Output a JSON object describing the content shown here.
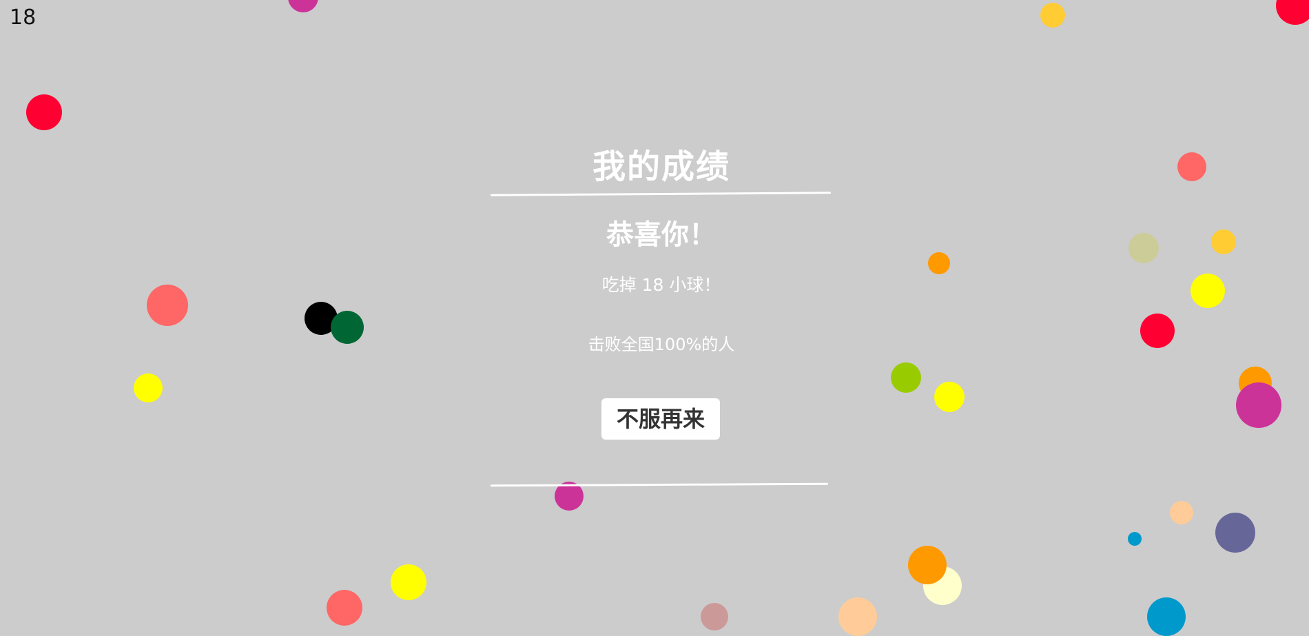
{
  "hud": {
    "score": "18"
  },
  "result": {
    "title": "我的成绩",
    "congrats": "恭喜你！",
    "eaten_text": "吃掉 18 小球！",
    "beat_text": "击败全国100%的人",
    "retry_label": "不服再来"
  },
  "colors": {
    "background": "#cccccc",
    "text": "#ffffff",
    "button_bg": "#ffffff",
    "button_text": "#333333"
  },
  "balls": [
    {
      "color": "#cc3399"
    },
    {
      "color": "#ffcc33"
    },
    {
      "color": "#ff0033"
    },
    {
      "color": "#ff0033"
    },
    {
      "color": "#ff6666"
    },
    {
      "color": "#ff6666"
    },
    {
      "color": "#cccc99"
    },
    {
      "color": "#ffcc33"
    },
    {
      "color": "#ff9900"
    },
    {
      "color": "#ffff00"
    },
    {
      "color": "#000000"
    },
    {
      "color": "#006633"
    },
    {
      "color": "#ff0033"
    },
    {
      "color": "#ffff00"
    },
    {
      "color": "#99cc00"
    },
    {
      "color": "#ffff00"
    },
    {
      "color": "#ff9900"
    },
    {
      "color": "#cc3399"
    },
    {
      "color": "#cc3399"
    },
    {
      "color": "#ffcc99"
    },
    {
      "color": "#666699"
    },
    {
      "color": "#0099cc"
    },
    {
      "color": "#ffffcc"
    },
    {
      "color": "#ff9900"
    },
    {
      "color": "#ffff00"
    },
    {
      "color": "#ff6666"
    },
    {
      "color": "#cc9999"
    },
    {
      "color": "#ffcc99"
    },
    {
      "color": "#0099cc"
    }
  ]
}
